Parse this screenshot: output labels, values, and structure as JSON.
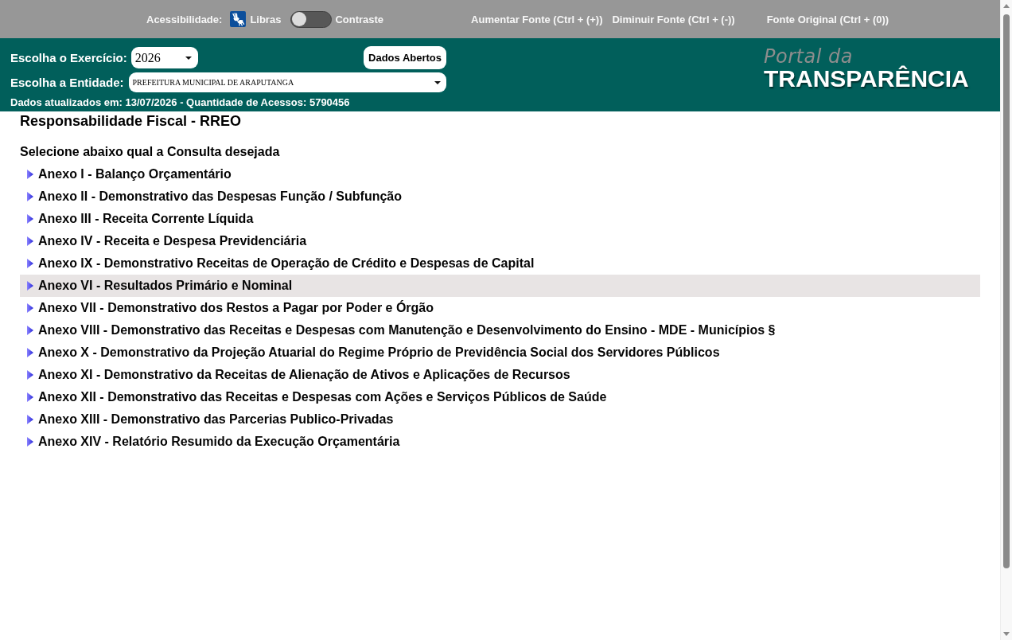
{
  "accessibility_bar": {
    "label": "Acessibilidade:",
    "libras": "Libras",
    "contrast": {
      "label": "Contraste",
      "on": false
    },
    "font_controls": [
      "Aumentar Fonte (Ctrl + (+))",
      "Diminuir Fonte (Ctrl + (-))",
      "Fonte Original (Ctrl + (0))"
    ]
  },
  "header": {
    "exercise": {
      "label": "Escolha o Exercício:",
      "value": "2026"
    },
    "open_data_button": "Dados Abertos",
    "entity": {
      "label": "Escolha a Entidade:",
      "value": "PREFEITURA MUNICIPAL DE ARAPUTANGA"
    },
    "update_info": "Dados atualizados em: 13/07/2026 - Quantidade de Acessos: 5790456",
    "logo": {
      "line_1": "Portal da",
      "line_2": "TRANSPARÊNCIA"
    }
  },
  "content": {
    "title": "Responsabilidade Fiscal - RREO",
    "prompt": "Selecione abaixo qual a Consulta desejada",
    "reports": [
      {
        "label": "Anexo I - Balanço Orçamentário",
        "selected": false
      },
      {
        "label": "Anexo II - Demonstrativo das Despesas Função / Subfunção",
        "selected": false
      },
      {
        "label": "Anexo III - Receita Corrente Líquida",
        "selected": false
      },
      {
        "label": "Anexo IV - Receita e Despesa Previdenciária",
        "selected": false
      },
      {
        "label": "Anexo IX - Demonstrativo Receitas de Operação de Crédito e Despesas de Capital",
        "selected": false
      },
      {
        "label": "Anexo VI - Resultados Primário e Nominal",
        "selected": true
      },
      {
        "label": "Anexo VII - Demonstrativo dos Restos a Pagar por Poder e Órgão",
        "selected": false
      },
      {
        "label": "Anexo VIII - Demonstrativo das Receitas e Despesas com Manutenção e Desenvolvimento do Ensino - MDE - Municípios §",
        "selected": false
      },
      {
        "label": "Anexo X - Demonstrativo da Projeção Atuarial do Regime Próprio de Previdência Social dos Servidores Públicos",
        "selected": false
      },
      {
        "label": "Anexo XI - Demonstrativo da Receitas de Alienação de Ativos e Aplicações de Recursos",
        "selected": false
      },
      {
        "label": "Anexo XII - Demonstrativo das Receitas e Despesas com Ações e Serviços Públicos de Saúde",
        "selected": false
      },
      {
        "label": "Anexo XIII - Demonstrativo das Parcerias Publico-Privadas",
        "selected": false
      },
      {
        "label": "Anexo XIV - Relatório Resumido da Execução Orçamentária",
        "selected": false
      }
    ]
  }
}
